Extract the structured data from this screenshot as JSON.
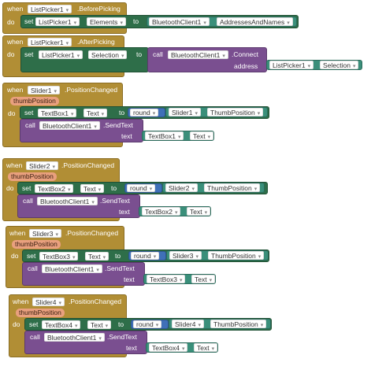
{
  "blocks": {
    "bp": {
      "when": "when",
      "comp": "ListPicker1",
      "event": ".BeforePicking",
      "do": "do",
      "set": "set",
      "target": "ListPicker1",
      "prop": "Elements",
      "to": "to",
      "src": "BluetoothClient1",
      "srcprop": "AddressesAndNames"
    },
    "ap": {
      "when": "when",
      "comp": "ListPicker1",
      "event": ".AfterPicking",
      "do": "do",
      "set": "set",
      "target": "ListPicker1",
      "prop": "Selection",
      "to": "to",
      "call": "call",
      "callcomp": "BluetoothClient1",
      "method": ".Connect",
      "arg": "address",
      "argcomp": "ListPicker1",
      "argprop": "Selection"
    },
    "s1": {
      "when": "when",
      "comp": "Slider1",
      "event": ".PositionChanged",
      "param": "thumbPosition",
      "do": "do",
      "set": "set",
      "target": "TextBox1",
      "prop": "Text",
      "to": "to",
      "round": "round",
      "src": "Slider1",
      "srcprop": "ThumbPosition",
      "call": "call",
      "callcomp": "BluetoothClient1",
      "method": ".SendText",
      "arg": "text",
      "argcomp": "TextBox1",
      "argprop": "Text"
    },
    "s2": {
      "when": "when",
      "comp": "Slider2",
      "event": ".PositionChanged",
      "param": "thumbPosition",
      "do": "do",
      "set": "set",
      "target": "TextBox2",
      "prop": "Text",
      "to": "to",
      "round": "round",
      "src": "Slider2",
      "srcprop": "ThumbPosition",
      "call": "call",
      "callcomp": "BluetoothClient1",
      "method": ".SendText",
      "arg": "text",
      "argcomp": "TextBox2",
      "argprop": "Text"
    },
    "s3": {
      "when": "when",
      "comp": "Slider3",
      "event": ".PositionChanged",
      "param": "thumbPosition",
      "do": "do",
      "set": "set",
      "target": "TextBox3",
      "prop": "Text",
      "to": "to",
      "round": "round",
      "src": "Slider3",
      "srcprop": "ThumbPosition",
      "call": "call",
      "callcomp": "BluetoothClient1",
      "method": ".SendText",
      "arg": "text",
      "argcomp": "TextBox3",
      "argprop": "Text"
    },
    "s4": {
      "when": "when",
      "comp": "Slider4",
      "event": ".PositionChanged",
      "param": "thumbPosition",
      "do": "do",
      "set": "set",
      "target": "TextBox4",
      "prop": "Text",
      "to": "to",
      "round": "round",
      "src": "Slider4",
      "srcprop": "ThumbPosition",
      "call": "call",
      "callcomp": "BluetoothClient1",
      "method": ".SendText",
      "arg": "text",
      "argcomp": "TextBox4",
      "argprop": "Text"
    }
  },
  "dropdown_icon": "chevron-down-icon"
}
